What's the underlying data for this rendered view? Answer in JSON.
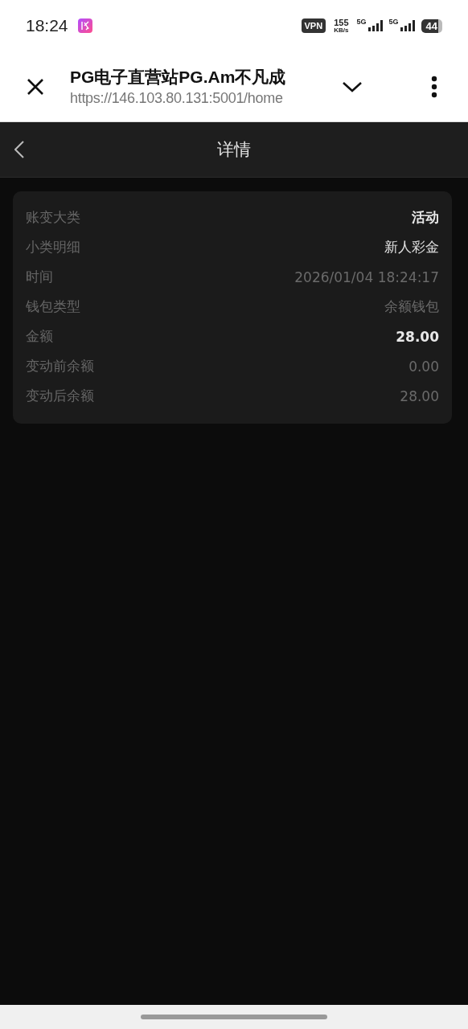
{
  "status_bar": {
    "time": "18:24",
    "vpn": "VPN",
    "speed": "155",
    "speed_unit": "KB/s",
    "network_1": "5G",
    "network_2": "5G",
    "battery": "44"
  },
  "browser_bar": {
    "title": "PG电子直营站PG.Am不凡成",
    "url": "https://146.103.80.131:5001/home"
  },
  "header": {
    "title": "详情"
  },
  "details": [
    {
      "label": "账变大类",
      "value": "活动",
      "kind": "bold"
    },
    {
      "label": "小类明细",
      "value": "新人彩金",
      "kind": "plain"
    },
    {
      "label": "时间",
      "value": "2026/01/04 18:24:17",
      "kind": "muted"
    },
    {
      "label": "钱包类型",
      "value": "余额钱包",
      "kind": "muted"
    },
    {
      "label": "金额",
      "value": "28.00",
      "kind": "bold"
    },
    {
      "label": "变动前余额",
      "value": "0.00",
      "kind": "muted"
    },
    {
      "label": "变动后余额",
      "value": "28.00",
      "kind": "muted"
    }
  ]
}
